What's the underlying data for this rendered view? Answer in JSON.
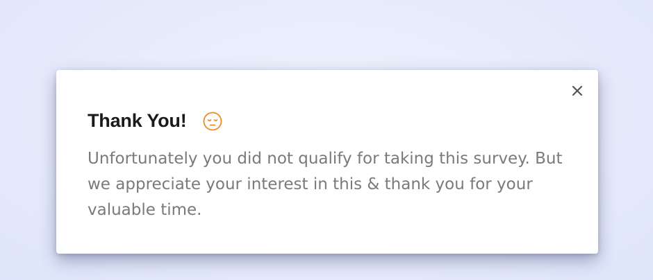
{
  "dialog": {
    "title": "Thank You!",
    "message": "Unfortunately you did not qualify for taking this survey. But we appreciate your interest in this & thank you for your valuable time.",
    "close_icon": "close-icon",
    "emoji_icon": "sad-face-icon"
  },
  "colors": {
    "background": "#e6ebfb",
    "dialog_background": "#ffffff",
    "title": "#1a1a1a",
    "message": "#7a7a7a",
    "emoji": "#f08a24",
    "close_icon": "#555555"
  }
}
